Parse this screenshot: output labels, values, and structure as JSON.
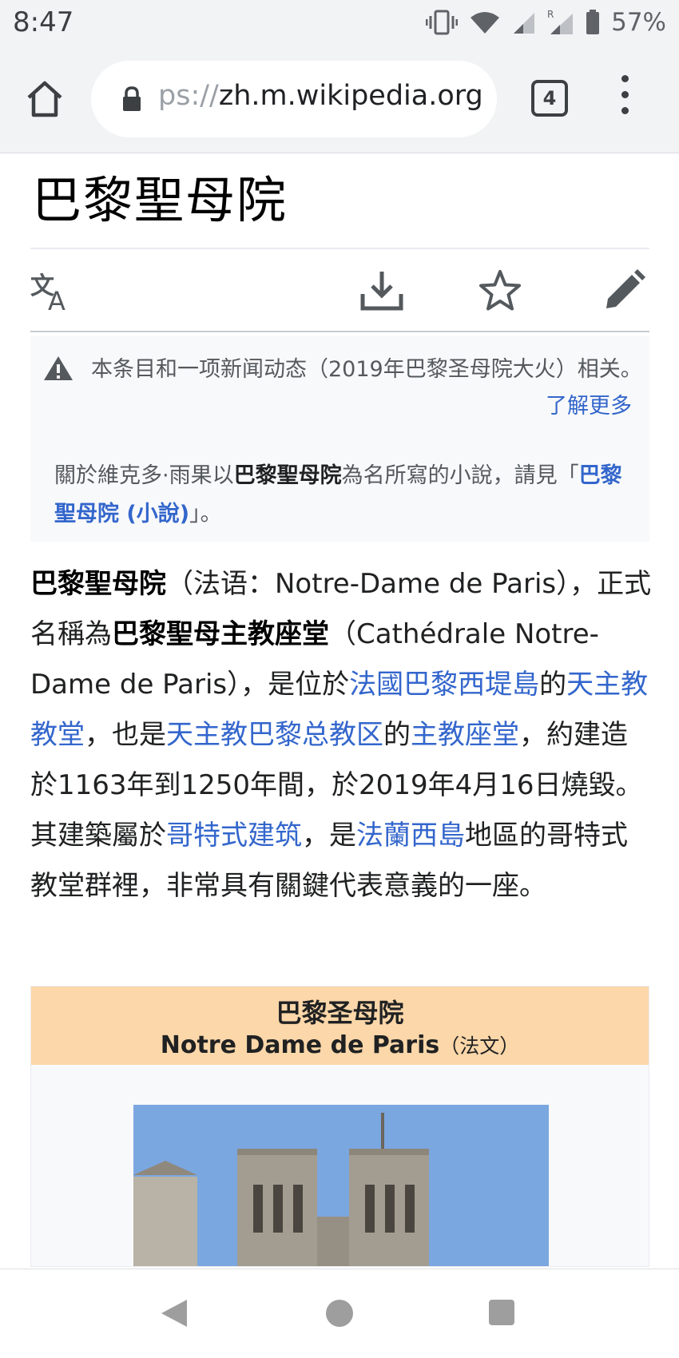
{
  "status_bar": {
    "time": "8:47",
    "battery_percent": "57%",
    "signal_label": "R"
  },
  "browser": {
    "url_prefix": "ps://",
    "url_domain": "zh.m.wikipedia.org",
    "tab_count": "4"
  },
  "page": {
    "title": "巴黎聖母院"
  },
  "notice": {
    "text": "本条目和一项新闻动态（2019年巴黎圣母院大火）相关。",
    "learn_more": "了解更多"
  },
  "hatnote": {
    "prefix": "關於維克多·雨果以",
    "bold": "巴黎聖母院",
    "middle": "為名所寫的小說，請見",
    "open_quote": "「",
    "link": "巴黎聖母院 (小說)",
    "close_quote": "」。"
  },
  "intro": {
    "bold1": "巴黎聖母院",
    "t1": "（法语：Notre-Dame de Paris），正式名稱為",
    "bold2": "巴黎聖母主教座堂",
    "t2": "（Cathédrale Notre-Dame de Paris），是位於",
    "link1": "法國巴黎西堤島",
    "t3": "的",
    "link2": "天主教教堂",
    "t4": "，也是",
    "link3": "天主教巴黎总教区",
    "t5": "的",
    "link4": "主教座堂",
    "t6": "，約建造於1163年到1250年間，於2019年4月16日燒毀。其建築屬於",
    "link5": "哥特式建筑",
    "t7": "，是",
    "link6": "法蘭西島",
    "t8": "地區的哥特式教堂群裡，非常具有關鍵代表意義的一座。"
  },
  "infobox": {
    "title": "巴黎圣母院",
    "subtitle": "Notre Dame de Paris",
    "subtitle_note": "（法文）"
  },
  "colors": {
    "link": "#3366cc",
    "infobox_header": "#fbd7a9",
    "chrome_bg": "#f1f3f4"
  }
}
